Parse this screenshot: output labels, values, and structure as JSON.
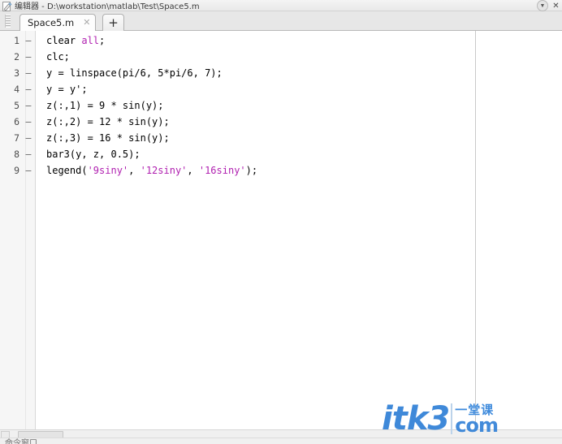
{
  "window": {
    "title": "编辑器 - D:\\workstation\\matlab\\Test\\Space5.m",
    "icon": "pencil-document-icon",
    "undock_label": "▼",
    "close_label": "✕"
  },
  "tabs": {
    "grip": "drag-grip",
    "items": [
      {
        "label": "Space5.m",
        "close": "✕",
        "active": true
      }
    ],
    "add_label": "+"
  },
  "editor": {
    "lines": [
      {
        "num": "1",
        "mark": "—",
        "segments": [
          {
            "text": "clear ",
            "style": "plain"
          },
          {
            "text": "all",
            "style": "str"
          },
          {
            "text": ";",
            "style": "plain"
          }
        ]
      },
      {
        "num": "2",
        "mark": "—",
        "segments": [
          {
            "text": "clc;",
            "style": "plain"
          }
        ]
      },
      {
        "num": "3",
        "mark": "—",
        "segments": [
          {
            "text": "y = linspace(pi/6, 5*pi/6, 7);",
            "style": "plain"
          }
        ]
      },
      {
        "num": "4",
        "mark": "—",
        "segments": [
          {
            "text": "y = y';",
            "style": "plain"
          }
        ]
      },
      {
        "num": "5",
        "mark": "—",
        "segments": [
          {
            "text": "z(:,1) = 9 * sin(y);",
            "style": "plain"
          }
        ]
      },
      {
        "num": "6",
        "mark": "—",
        "segments": [
          {
            "text": "z(:,2) = 12 * sin(y);",
            "style": "plain"
          }
        ]
      },
      {
        "num": "7",
        "mark": "—",
        "segments": [
          {
            "text": "z(:,3) = 16 * sin(y);",
            "style": "plain"
          }
        ]
      },
      {
        "num": "8",
        "mark": "—",
        "segments": [
          {
            "text": "bar3(y, z, 0.5);",
            "style": "plain"
          }
        ]
      },
      {
        "num": "9",
        "mark": "—",
        "segments": [
          {
            "text": "legend(",
            "style": "plain"
          },
          {
            "text": "'9siny'",
            "style": "str"
          },
          {
            "text": ", ",
            "style": "plain"
          },
          {
            "text": "'12siny'",
            "style": "str"
          },
          {
            "text": ", ",
            "style": "plain"
          },
          {
            "text": "'16siny'",
            "style": "str"
          },
          {
            "text": ");",
            "style": "plain"
          }
        ]
      }
    ]
  },
  "statusbar": {
    "text": "命令窗口"
  },
  "watermark": {
    "brand": "itk3",
    "cn": "一堂课",
    "domain": "com"
  },
  "colors": {
    "string_literal": "#b020b0",
    "code_text": "#000000",
    "watermark_blue": "#2f7fd6",
    "gutter_bg": "#f6f6f6",
    "tabstrip_bg": "#e7e7e7"
  }
}
